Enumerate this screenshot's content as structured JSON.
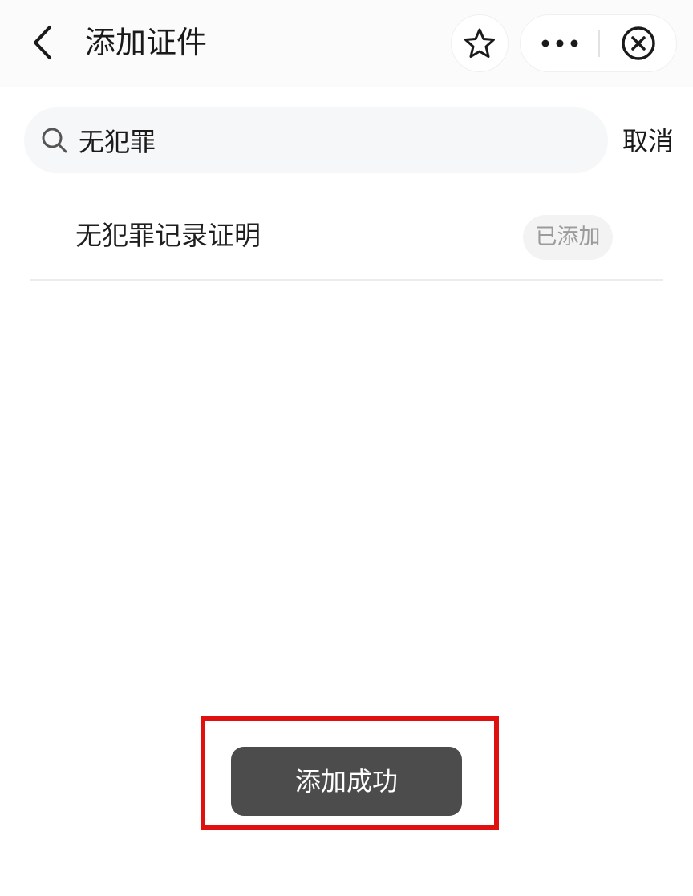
{
  "header": {
    "title": "添加证件",
    "back_icon": "chevron-left-icon",
    "star_icon": "star-icon",
    "more_icon": "more-dots-icon",
    "close_icon": "close-circle-icon"
  },
  "search": {
    "value": "无犯罪",
    "icon": "search-icon",
    "cancel_label": "取消"
  },
  "results": [
    {
      "label": "无犯罪记录证明",
      "status": "已添加"
    }
  ],
  "toast": {
    "message": "添加成功"
  },
  "colors": {
    "highlight_border": "#e01010",
    "toast_background": "#4c4c4c",
    "badge_text": "#9b9b9b"
  }
}
